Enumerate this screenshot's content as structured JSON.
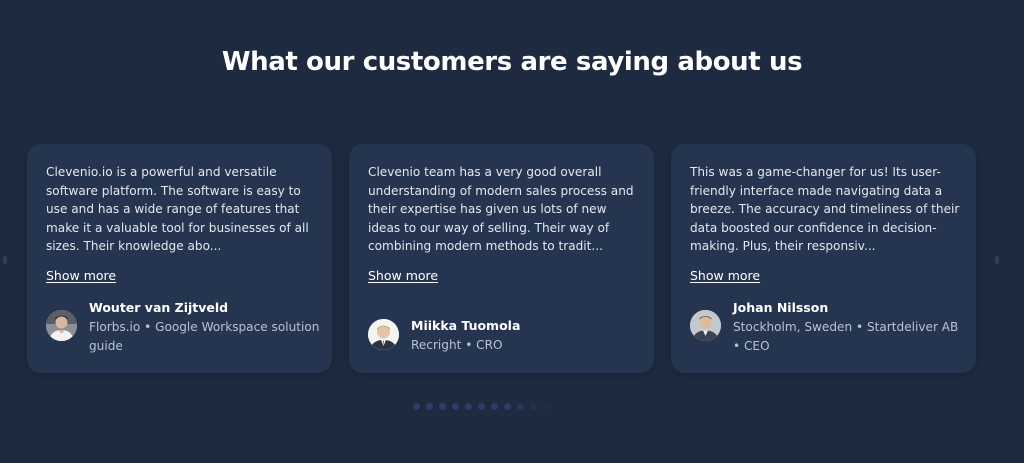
{
  "section": {
    "title": "What our customers are saying about us"
  },
  "testimonials": [
    {
      "quote": "Clevenio.io is a powerful and versatile software platform. The software is easy to use and has a wide range of features that make it a valuable tool for businesses of all sizes. Their knowledge abo...",
      "show_more": "Show more",
      "name": "Wouter van Zijtveld",
      "meta": "Florbs.io • Google Workspace solution guide",
      "avatar_icon": "person-photo-icon"
    },
    {
      "quote": "Clevenio team has a very good overall understanding of modern sales process and their expertise has given us lots of new ideas to our way of selling. Their way of combining modern methods to tradit...",
      "show_more": "Show more",
      "name": "Miikka Tuomola",
      "meta": "Recright • CRO",
      "avatar_icon": "person-photo-icon"
    },
    {
      "quote": "This was a game-changer for us! Its user-friendly interface made navigating data a breeze. The accuracy and timeliness of their data boosted our confidence in decision-making. Plus, their responsiv...",
      "show_more": "Show more",
      "name": "Johan Nilsson",
      "meta": "Stockholm, Sweden • Startdeliver AB • CEO",
      "avatar_icon": "person-photo-icon"
    }
  ],
  "pagination": {
    "dot_count": 11,
    "active_index": 0
  },
  "colors": {
    "background": "#1d2a40",
    "card": "#26354f",
    "text": "#e4e8ef",
    "muted": "#b9c2d0",
    "dot": "#2a3f66"
  }
}
